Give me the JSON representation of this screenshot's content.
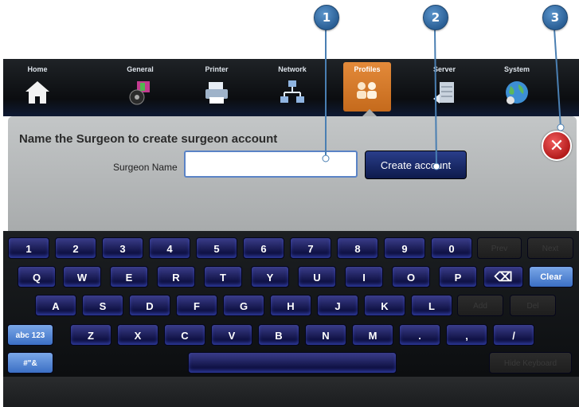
{
  "callouts": [
    "1",
    "2",
    "3"
  ],
  "nav": {
    "tabs": [
      {
        "label": "Home",
        "icon": "house-icon"
      },
      {
        "label": "General",
        "icon": "speaker-icon"
      },
      {
        "label": "Printer",
        "icon": "printer-icon"
      },
      {
        "label": "Network",
        "icon": "network-icon"
      },
      {
        "label": "Profiles",
        "icon": "profiles-icon",
        "active": true
      },
      {
        "label": "Server",
        "icon": "server-icon"
      },
      {
        "label": "System",
        "icon": "globe-icon"
      }
    ]
  },
  "dialog": {
    "title": "Name the Surgeon to create surgeon account",
    "surgeon_label": "Surgeon Name",
    "surgeon_value": "",
    "create_label": "Create account",
    "close_glyph": "✕"
  },
  "keyboard": {
    "row1": [
      "1",
      "2",
      "3",
      "4",
      "5",
      "6",
      "7",
      "8",
      "9",
      "0"
    ],
    "row1_extra": [
      "Prev",
      "Next"
    ],
    "row2": [
      "Q",
      "W",
      "E",
      "R",
      "T",
      "Y",
      "U",
      "I",
      "O",
      "P"
    ],
    "backspace": "⌫",
    "clear": "Clear",
    "row3": [
      "A",
      "S",
      "D",
      "F",
      "G",
      "H",
      "J",
      "K",
      "L"
    ],
    "row3_extra": [
      "Add",
      "Del"
    ],
    "row4": [
      "Z",
      "X",
      "C",
      "V",
      "B",
      "N",
      "M",
      ".",
      ",",
      "/"
    ],
    "mode_abc": "abc 123",
    "mode_sym": "#\"&",
    "space": "",
    "hide": "Hide Keyboard"
  },
  "colors": {
    "accent_active_tab": "#d67a2a",
    "key_blue": "#1f2470",
    "close_red": "#d42a2a",
    "callout_blue": "#3d75ad"
  }
}
